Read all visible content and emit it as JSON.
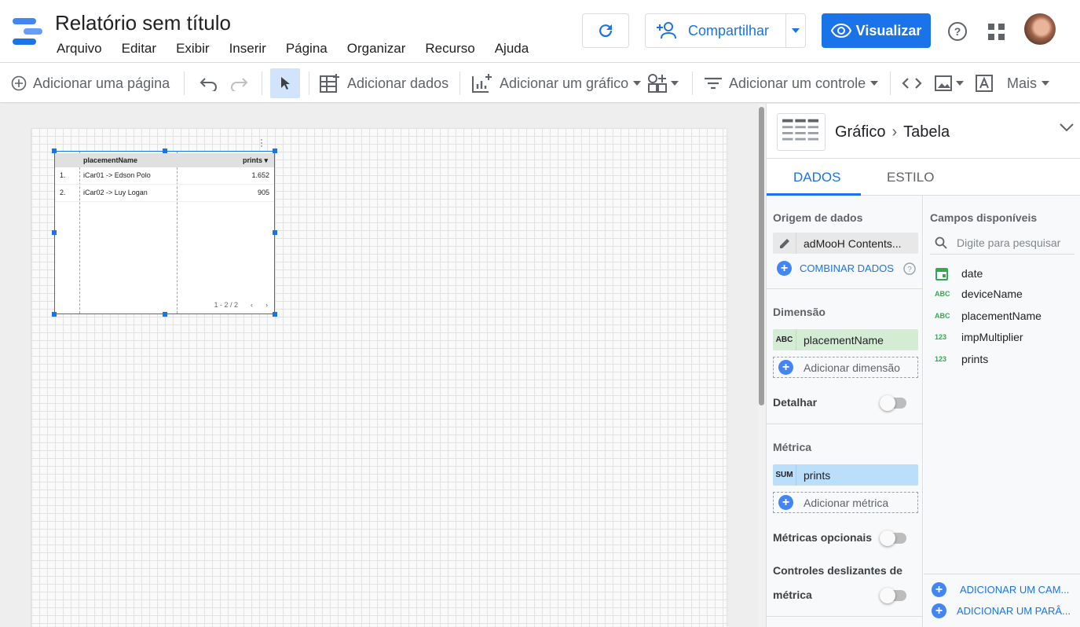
{
  "header": {
    "title": "Relatório sem título",
    "menu": [
      "Arquivo",
      "Editar",
      "Exibir",
      "Inserir",
      "Página",
      "Organizar",
      "Recurso",
      "Ajuda"
    ],
    "share_label": "Compartilhar",
    "view_label": "Visualizar",
    "accent": "#1a73e8"
  },
  "toolbar": {
    "add_page": "Adicionar uma página",
    "add_data": "Adicionar dados",
    "add_chart": "Adicionar um gráfico",
    "add_control": "Adicionar um controle",
    "more": "Mais"
  },
  "table": {
    "col1": "placementName",
    "col2": "prints",
    "rows": [
      {
        "n": "1.",
        "name": "iCar01 -> Edson Polo",
        "value": "1.652"
      },
      {
        "n": "2.",
        "name": "iCar02 -> Luy Logan",
        "value": "905"
      }
    ],
    "pager": "1 - 2 / 2"
  },
  "panel": {
    "crumb_root": "Gráfico",
    "crumb_leaf": "Tabela",
    "tab_data": "DADOS",
    "tab_style": "ESTILO",
    "source_title": "Origem de dados",
    "source_name": "adMooH Contents...",
    "blend_label": "COMBINAR DADOS",
    "dimension_title": "Dimensão",
    "dimension_tag": "ABC",
    "dimension_value": "placementName",
    "add_dimension": "Adicionar dimensão",
    "drill_label": "Detalhar",
    "metric_title": "Métrica",
    "metric_tag": "SUM",
    "metric_value": "prints",
    "add_metric": "Adicionar métrica",
    "optional_metrics": "Métricas opcionais",
    "slider_label_1": "Controles deslizantes de",
    "slider_label_2": "métrica",
    "fields_title": "Campos disponíveis",
    "search_placeholder": "Digite para pesquisar",
    "fields": [
      {
        "tag": "",
        "name": "date"
      },
      {
        "tag": "ABC",
        "name": "deviceName"
      },
      {
        "tag": "ABC",
        "name": "placementName"
      },
      {
        "tag": "123",
        "name": "impMultiplier"
      },
      {
        "tag": "123",
        "name": "prints"
      }
    ],
    "add_field": "ADICIONAR UM CAM...",
    "add_param": "ADICIONAR UM PARÂ..."
  }
}
